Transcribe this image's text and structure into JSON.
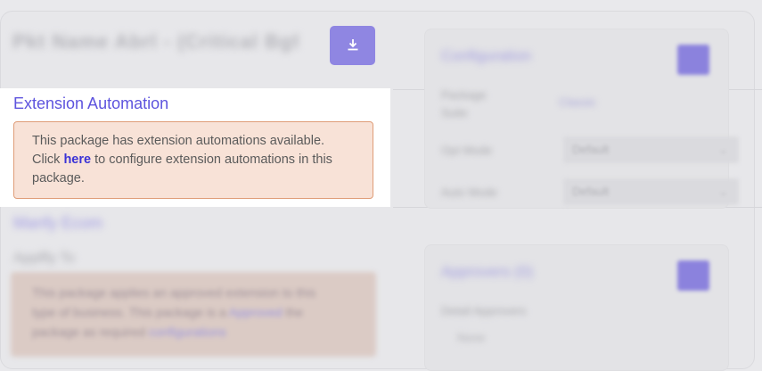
{
  "header": {
    "package_title": "Pkt Name Abrl - (Critical Bgfrwd)",
    "download_icon": "download-icon"
  },
  "extension_automation": {
    "title": "Extension Automation",
    "notice_prefix": "This package has extension automations available. Click ",
    "notice_link": "here",
    "notice_suffix": " to configure extension automations in this package."
  },
  "blurred_section": {
    "link_text": "Manfy Ecom",
    "label": "Applfly To",
    "notice_line1": "This package applies an approved extension to this",
    "notice_line2": "type of business. This package is a ",
    "notice_link1": "Approved",
    "notice_line3": " the",
    "notice_line4": "package as required ",
    "notice_link2": "configurations"
  },
  "config_card": {
    "title": "Configuration",
    "rows": [
      {
        "label": "Package Suite",
        "value": "Classic"
      },
      {
        "label": "Opt Mode",
        "value": "Default"
      },
      {
        "label": "Auto Mode",
        "value": "Default"
      }
    ]
  },
  "approvers_card": {
    "title": "Approvers (0)",
    "label": "Detail Approvers",
    "value": "None"
  },
  "colors": {
    "accent": "#5e54de",
    "button": "#8f86e2",
    "notice_bg": "#f8e2d7",
    "notice_border": "#df9d78"
  }
}
